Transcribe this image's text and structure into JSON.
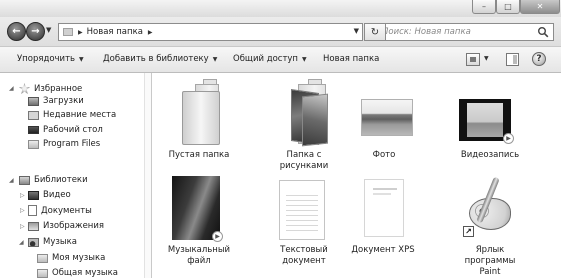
{
  "window": {
    "controls": {
      "minimize": "–",
      "maximize": "□",
      "close": "✕"
    }
  },
  "address_bar": {
    "back": "←",
    "forward": "→",
    "path": "Новая папка",
    "refresh": "↻",
    "search_placeholder": "Поиск: Новая папка"
  },
  "command_bar": {
    "organize": "Упорядочить",
    "add_to_library": "Добавить в библиотеку",
    "share": "Общий доступ",
    "new_folder": "Новая папка",
    "help": "?"
  },
  "nav_pane": {
    "favorites_header": "Избранное",
    "favorites": [
      "Загрузки",
      "Недавние места",
      "Рабочий стол",
      "Program Files"
    ],
    "libraries_header": "Библиотеки",
    "libraries": [
      "Видео",
      "Документы",
      "Изображения",
      "Музыка"
    ],
    "music_children": [
      "Моя музыка",
      "Общая музыка"
    ]
  },
  "files": {
    "empty_folder": {
      "line1": "Пустая папка",
      "line2": ""
    },
    "folder_pictures": {
      "line1": "Папка с",
      "line2": "рисунками"
    },
    "photo": {
      "line1": "Фото",
      "line2": ""
    },
    "video": {
      "line1": "Видеозапись",
      "line2": ""
    },
    "music_file": {
      "line1": "Музыкальный",
      "line2": "файл"
    },
    "text_document": {
      "line1": "Текстовый",
      "line2": "документ"
    },
    "xps_document": {
      "line1": "Документ XPS",
      "line2": ""
    },
    "paint_shortcut": {
      "line1": "Ярлык",
      "line2": "программы",
      "line3": "Paint"
    }
  }
}
